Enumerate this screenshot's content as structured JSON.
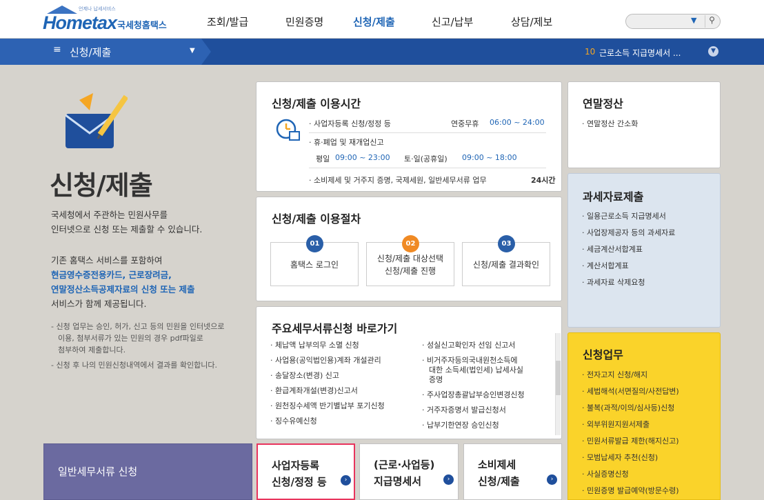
{
  "header": {
    "logo_text": "Hometax",
    "logo_sub": "국세청홈택스",
    "logo_tag": "언제나 납세서비스",
    "nav": [
      "조회/발급",
      "민원증명",
      "신청/제출",
      "신고/납부",
      "상담/제보"
    ],
    "search_placeholder": ""
  },
  "bar": {
    "title": "신청/제출",
    "rank_number": "10",
    "rank_text": "근로소득 지급명세서 ..."
  },
  "intro": {
    "title": "신청/제출",
    "desc_1": "국세청에서 주관하는 민원사무를",
    "desc_2": "인터넷으로 신청 또는 제출할 수 있습니다.",
    "desc_3": "기존 홈택스 서비스를 포함하여",
    "desc_blue_1": "현금영수증전용카드, 근로장려금,",
    "desc_blue_2": "연말정산소득공제자료의 신청 또는 제출",
    "desc_4": "서비스가 함께 제공됩니다.",
    "note_1a": "- 신청 업무는 승인, 허가, 신고 등의 민원을 인터넷으로",
    "note_1b": "이용, 첨부서류가 있는 민원의 경우 pdf파일로",
    "note_1c": "첨부하여 제출합니다.",
    "note_2": "- 신청 후 나의 민원신청내역에서 결과를 확인합니다."
  },
  "hours": {
    "title": "신청/제출 이용시간",
    "row1_label": "· 사업자등록 신청/정정 등",
    "row1_prefix": "연중무휴",
    "row1_time": "06:00 ~ 24:00",
    "row2_label": "· 휴·폐업 및 재개업신고",
    "row3_prefix": "평일",
    "row3_time1": "09:00 ~ 23:00",
    "row3_mid": "토·일(공휴일)",
    "row3_time2": "09:00 ~ 18:00",
    "row4_label": "· 소비제세 및 거주지 증명, 국제세원, 일반세무서류 업무",
    "row4_value": "24시간"
  },
  "procedure": {
    "title": "신청/제출 이용절차",
    "steps": [
      {
        "num": "01",
        "line1": "홈택스 로그인",
        "line2": "",
        "color": "#2a5fa8"
      },
      {
        "num": "02",
        "line1": "신청/제출 대상선택",
        "line2": "신청/제출 진행",
        "color": "#f08a24"
      },
      {
        "num": "03",
        "line1": "신청/제출 결과확인",
        "line2": "",
        "color": "#2a5fa8"
      }
    ]
  },
  "shortcuts": {
    "title": "주요세무서류신청 바로가기",
    "left": [
      "· 체납액 납부의무 소멸 신청",
      "· 사업용(공익법인용)계좌 개설관리",
      "· 송달장소(변경) 신고",
      "· 환급계좌개설(변경)신고서",
      "· 원천징수세액 반기별납부 포기신청",
      "· 징수유예신청"
    ],
    "right_1": "· 성실신고확인자 선임 신고서",
    "right_2a": "· 비거주자등의국내원천소득에",
    "right_2b": "대한 소득세(법인세) 납세사실",
    "right_2c": "증명",
    "right_3": "· 주사업장총괄납부승인변경신청",
    "right_4": "· 거주자증명서 발급신청서",
    "right_5": "· 납부기한연장 승인신청"
  },
  "yearend": {
    "title": "연말정산",
    "items": [
      "· 연말정산 간소화"
    ]
  },
  "taxdata": {
    "title": "과세자료제출",
    "items": [
      "· 일용근로소득 지급명세서",
      "· 사업장제공자 등의 과세자료",
      "· 세금계산서합계표",
      "· 계산서합계표",
      "· 과세자료 삭제요청"
    ]
  },
  "apply": {
    "title": "신청업무",
    "items": [
      "· 전자고지 신청/해지",
      "· 세법해석(서면질의/사전답변)",
      "· 불복(과적/이의/심사등)신청",
      "· 외부위원지원서제출",
      "· 민원서류발급 제한(해지신고)",
      "· 모범납세자 추천(신청)",
      "· 사실증명신청",
      "· 민원증명 발급예약(방문수령)"
    ]
  },
  "tiles": {
    "general": "일반세무서류 신청",
    "biz_1": "사업자등록",
    "biz_2": "신청/정정 등",
    "wage_1": "(근로·사업등)",
    "wage_2": "지급명세서",
    "cons_1": "소비제세",
    "cons_2": "신청/제출"
  },
  "colors": {
    "brand": "#1f65b5",
    "bar": "#1f4f9c",
    "orange": "#f08a24",
    "yellow_panel": "#fad32a",
    "purple_tile": "#6b6aa0",
    "highlight_border": "#e8335c"
  }
}
